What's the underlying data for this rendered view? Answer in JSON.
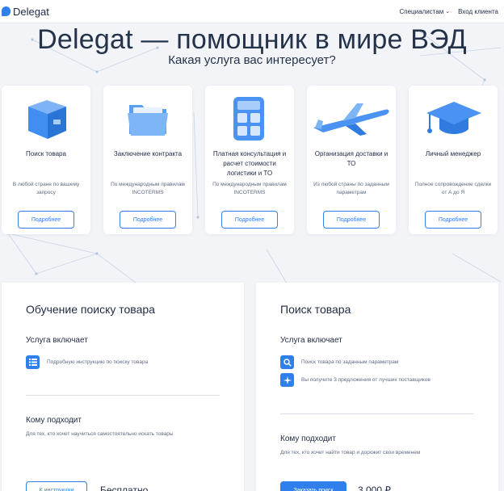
{
  "header": {
    "brand": "Delegat",
    "nav": [
      {
        "label": "Специалистам",
        "has_dropdown": true
      },
      {
        "label": "Вход клиента",
        "has_dropdown": false
      }
    ]
  },
  "hero": {
    "title": "Delegat — помощник в мире ВЭД",
    "subtitle": "Какая услуга вас интересует?"
  },
  "services": [
    {
      "icon": "package-box-icon",
      "title": "Поиск товара",
      "desc": "В любой стране по вашему запросу",
      "button": "Подробнее"
    },
    {
      "icon": "folder-icon",
      "title": "Заключение контракта",
      "desc": "По международным правилам INCOTERMS",
      "button": "Подробнее"
    },
    {
      "icon": "calculator-icon",
      "title": "Платная консультация и расчет стоимости логистики и ТО",
      "desc": "По международным правилам INCOTERMS",
      "button": "Подробнее"
    },
    {
      "icon": "airplane-icon",
      "title": "Организация доставки и ТО",
      "desc": "Из любой страны по заданным параметрам",
      "button": "Подробнее"
    },
    {
      "icon": "graduation-cap-icon",
      "title": "Личный менеджер",
      "desc": "Полное сопровождение сделки от А до Я",
      "button": "Подробнее"
    }
  ],
  "plans": [
    {
      "title": "Обучение поиску товара",
      "includes_heading": "Услуга включает",
      "features": [
        {
          "icon": "list-icon",
          "text": "Подробную инструкцию по поиску товара"
        }
      ],
      "audience_heading": "Кому подходит",
      "audience": "Для тех, кто хочет научиться самостоятельно искать товары",
      "button": "К инструкции",
      "price": "Бесплатно"
    },
    {
      "title": "Поиск товара",
      "includes_heading": "Услуга включает",
      "features": [
        {
          "icon": "search-icon",
          "text": "Поиск товара по заданным параметрам"
        },
        {
          "icon": "sparkle-icon",
          "text": "Вы получите 3 предложения от лучших поставщиков"
        }
      ],
      "audience_heading": "Кому подходит",
      "audience": "Для тех, кто хочет найти товар и дорожит свои временем",
      "button": "Заказать поиск",
      "price": "3 000 ₽"
    }
  ],
  "colors": {
    "accent": "#2f80ed",
    "background": "#f2f4f8",
    "text": "#1f2a44"
  }
}
